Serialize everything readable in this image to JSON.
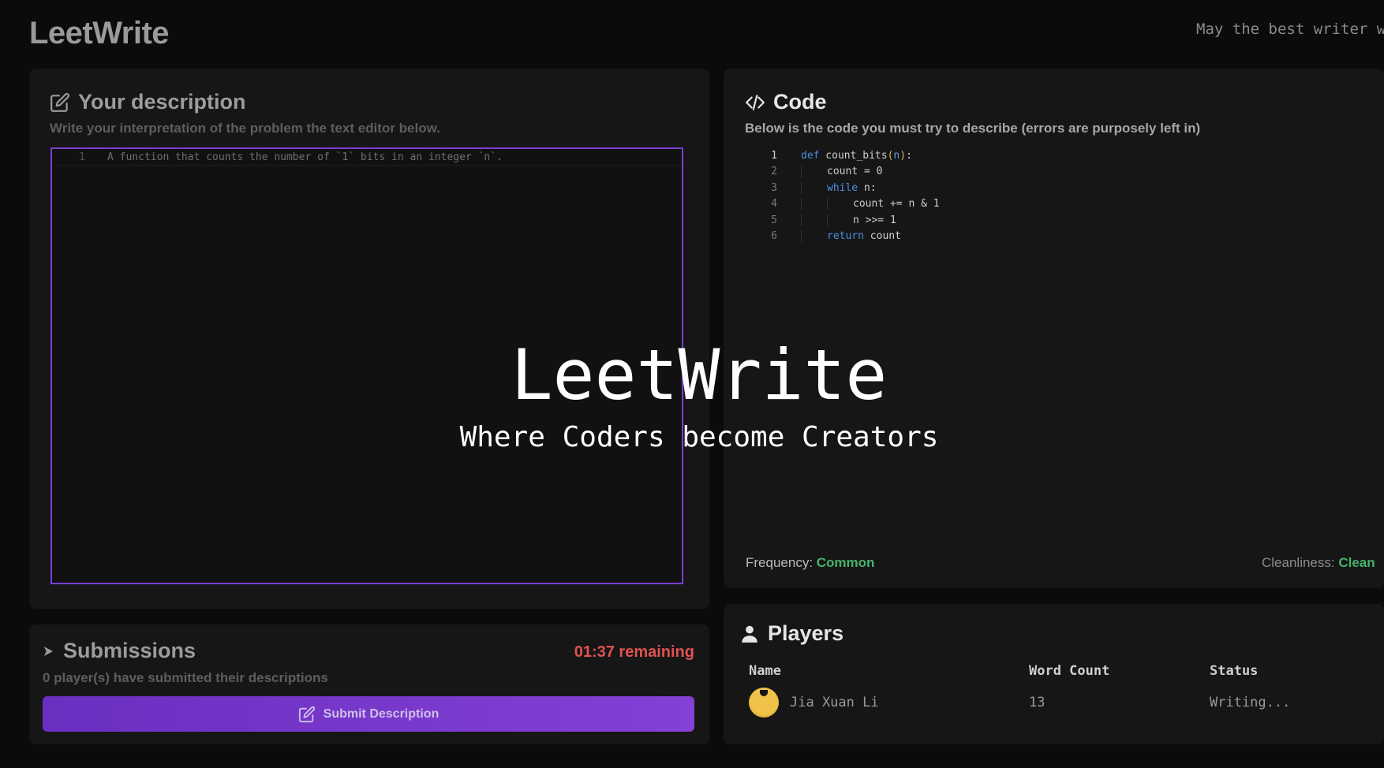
{
  "header": {
    "brand": "LeetWrite",
    "tagline": "May the best writer wi"
  },
  "description_panel": {
    "title": "Your description",
    "subtitle": "Write your interpretation of the problem the text editor below.",
    "editor_lines": [
      {
        "num": "1",
        "text": "A function that counts the number of `1` bits in an integer `n`."
      }
    ]
  },
  "code_panel": {
    "title": "Code",
    "subtitle": "Below is the code you must try to describe (errors are purposely left in)",
    "line_numbers": [
      "1",
      "2",
      "3",
      "4",
      "5",
      "6"
    ],
    "code": {
      "l1_kw": "def",
      "l1_name": " count_bits",
      "l1_open": "(",
      "l1_arg": "n",
      "l1_close": ")",
      "l1_colon": ":",
      "l2": "count = 0",
      "l3_kw": "while",
      "l3_rest": " n:",
      "l4": "count += n & 1",
      "l5": "n >>= 1",
      "l6_kw": "return",
      "l6_rest": " count"
    },
    "frequency_label": "Frequency: ",
    "frequency_value": "Common",
    "cleanliness_label": "Cleanliness: ",
    "cleanliness_value": "Clean"
  },
  "submissions": {
    "title": "Submissions",
    "subtitle": "0 player(s) have submitted their descriptions",
    "timer": "01:37 remaining",
    "button_label": "Submit Description"
  },
  "players": {
    "title": "Players",
    "columns": [
      "Name",
      "Word Count",
      "Status"
    ],
    "rows": [
      {
        "name": "Jia Xuan Li",
        "word_count": "13",
        "status": "Writing..."
      }
    ]
  },
  "overlay": {
    "title": "LeetWrite",
    "subtitle": "Where Coders become Creators"
  }
}
